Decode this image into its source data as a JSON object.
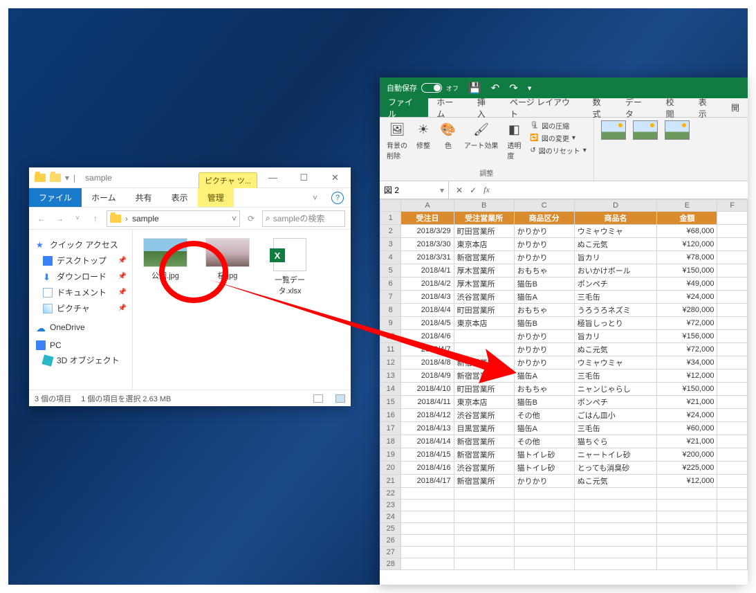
{
  "explorer": {
    "title": "sample",
    "tool_tab": "ピクチャ ツ...",
    "tabs": {
      "file": "ファイル",
      "home": "ホーム",
      "share": "共有",
      "view": "表示",
      "manage": "管理"
    },
    "address_folder": "sample",
    "search_placeholder": "sampleの検索",
    "nav": {
      "quick": "クイック アクセス",
      "desktop": "デスクトップ",
      "downloads": "ダウンロード",
      "documents": "ドキュメント",
      "pictures": "ピクチャ",
      "onedrive": "OneDrive",
      "pc": "PC",
      "obj3d": "3D オブジェクト"
    },
    "files": {
      "park": "公園.jpg",
      "sakura": "桜.jpg",
      "list": "一覧データ.xlsx"
    },
    "status": {
      "count": "3 個の項目",
      "selection": "1 個の項目を選択 2.63 MB"
    }
  },
  "excel": {
    "autosave": "自動保存",
    "autosave_state": "オフ",
    "tabs": {
      "file": "ファイル",
      "home": "ホーム",
      "insert": "挿入",
      "pagelayout": "ページ レイアウト",
      "formulas": "数式",
      "data": "データ",
      "review": "校閲",
      "view": "表示",
      "dev": "開"
    },
    "ribbon": {
      "remove_bg": "背景の\n削除",
      "corrections": "修整",
      "color": "色",
      "art": "アート効果",
      "transparency": "透明\n度",
      "compress": "図の圧縮",
      "change": "図の変更",
      "reset": "図のリセット",
      "group": "調整"
    },
    "namebox": "図 2",
    "columns": [
      "A",
      "B",
      "C",
      "D",
      "E",
      "F"
    ],
    "headers": [
      "受注日",
      "受注営業所",
      "商品区分",
      "商品名",
      "金額"
    ]
  },
  "chart_data": {
    "type": "table",
    "columns": [
      "受注日",
      "受注営業所",
      "商品区分",
      "商品名",
      "金額"
    ],
    "rows": [
      [
        "2018/3/29",
        "町田営業所",
        "かりかり",
        "ウミャウミャ",
        "¥68,000"
      ],
      [
        "2018/3/30",
        "東京本店",
        "かりかり",
        "ぬこ元気",
        "¥120,000"
      ],
      [
        "2018/3/31",
        "新宿営業所",
        "かりかり",
        "旨カリ",
        "¥78,000"
      ],
      [
        "2018/4/1",
        "厚木営業所",
        "おもちゃ",
        "おいかけボール",
        "¥150,000"
      ],
      [
        "2018/4/2",
        "厚木営業所",
        "猫缶B",
        "ポンペチ",
        "¥49,000"
      ],
      [
        "2018/4/3",
        "渋谷営業所",
        "猫缶A",
        "三毛缶",
        "¥24,000"
      ],
      [
        "2018/4/4",
        "町田営業所",
        "おもちゃ",
        "うろうろネズミ",
        "¥280,000"
      ],
      [
        "2018/4/5",
        "東京本店",
        "猫缶B",
        "極旨しっとり",
        "¥72,000"
      ],
      [
        "2018/4/6",
        "",
        "かりかり",
        "旨カリ",
        "¥156,000"
      ],
      [
        "2018/4/7",
        "",
        "かりかり",
        "ぬこ元気",
        "¥72,000"
      ],
      [
        "2018/4/8",
        "新宿営業所",
        "かりかり",
        "ウミャウミャ",
        "¥34,000"
      ],
      [
        "2018/4/9",
        "新宿営業所",
        "猫缶A",
        "三毛缶",
        "¥12,000"
      ],
      [
        "2018/4/10",
        "町田営業所",
        "おもちゃ",
        "ニャンじゃらし",
        "¥150,000"
      ],
      [
        "2018/4/11",
        "東京本店",
        "猫缶B",
        "ポンペチ",
        "¥21,000"
      ],
      [
        "2018/4/12",
        "渋谷営業所",
        "その他",
        "ごはん皿小",
        "¥24,000"
      ],
      [
        "2018/4/13",
        "目黒営業所",
        "猫缶A",
        "三毛缶",
        "¥60,000"
      ],
      [
        "2018/4/14",
        "新宿営業所",
        "その他",
        "猫ちぐら",
        "¥21,000"
      ],
      [
        "2018/4/15",
        "新宿営業所",
        "猫トイレ砂",
        "ニャートイレ砂",
        "¥200,000"
      ],
      [
        "2018/4/16",
        "渋谷営業所",
        "猫トイレ砂",
        "とっても消臭砂",
        "¥225,000"
      ],
      [
        "2018/4/17",
        "新宿営業所",
        "かりかり",
        "ぬこ元気",
        "¥12,000"
      ]
    ]
  }
}
